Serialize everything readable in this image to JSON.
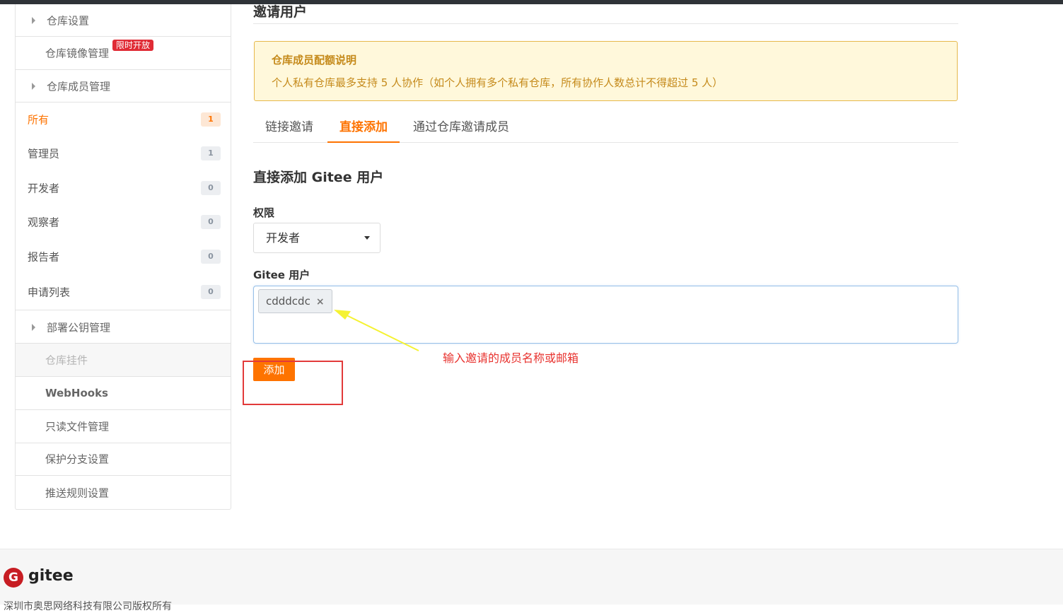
{
  "sidebar": {
    "repo_settings": "仓库设置",
    "mirror_management": "仓库镜像管理",
    "limited_badge": "限时开放",
    "member_management": "仓库成员管理",
    "roles": [
      {
        "label": "所有",
        "count": "1"
      },
      {
        "label": "管理员",
        "count": "1"
      },
      {
        "label": "开发者",
        "count": "0"
      },
      {
        "label": "观察者",
        "count": "0"
      },
      {
        "label": "报告者",
        "count": "0"
      },
      {
        "label": "申请列表",
        "count": "0"
      }
    ],
    "deploy_keys": "部署公钥管理",
    "repo_plugins": "仓库挂件",
    "webhooks": "WebHooks",
    "readonly_files": "只读文件管理",
    "protected_branches": "保护分支设置",
    "push_rules": "推送规则设置"
  },
  "main": {
    "title": "邀请用户",
    "notice": {
      "title": "仓库成员配额说明",
      "text": "个人私有仓库最多支持 5 人协作（如个人拥有多个私有仓库，所有协作人数总计不得超过 5 人）"
    },
    "tabs": [
      "链接邀请",
      "直接添加",
      "通过仓库邀请成员"
    ],
    "section_title": "直接添加 Gitee 用户",
    "permission_label": "权限",
    "permission_value": "开发者",
    "user_label": "Gitee 用户",
    "user_tag": "cdddcdc",
    "tag_remove": "×",
    "add_button": "添加",
    "annotation": "输入邀请的成员名称或邮箱"
  },
  "footer": {
    "logo_text": "gitee",
    "logo_glyph": "G",
    "copyright": "深圳市奥思网络科技有限公司版权所有"
  },
  "colors": {
    "accent": "#fe7300",
    "badge_red": "#e02b35",
    "annotation_red": "#e8332f",
    "arrow_yellow": "#f5f232"
  }
}
